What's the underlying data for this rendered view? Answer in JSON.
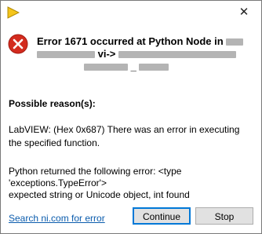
{
  "window": {
    "close_glyph": "✕"
  },
  "error": {
    "title_line1": "Error 1671 occurred at Python Node in",
    "title_line2": "vi->",
    "title_line3": "_"
  },
  "section": {
    "title": "Possible reason(s):"
  },
  "messages": {
    "labview": "LabVIEW: (Hex 0x687) There was an error in executing the specified function.",
    "python": [
      "Python returned the following error: <type",
      "'exceptions.TypeError'>",
      "expected string or Unicode object, int found"
    ]
  },
  "footer": {
    "link": "Search ni.com for error",
    "continue_label": "Continue",
    "stop_label": "Stop"
  },
  "icons": {
    "app": "labview-icon",
    "close": "close-icon",
    "error": "error-icon"
  },
  "colors": {
    "link": "#0b5cad",
    "error_red": "#d32b1e",
    "primary_border": "#0078d7",
    "button_bg": "#e1e1e1"
  }
}
